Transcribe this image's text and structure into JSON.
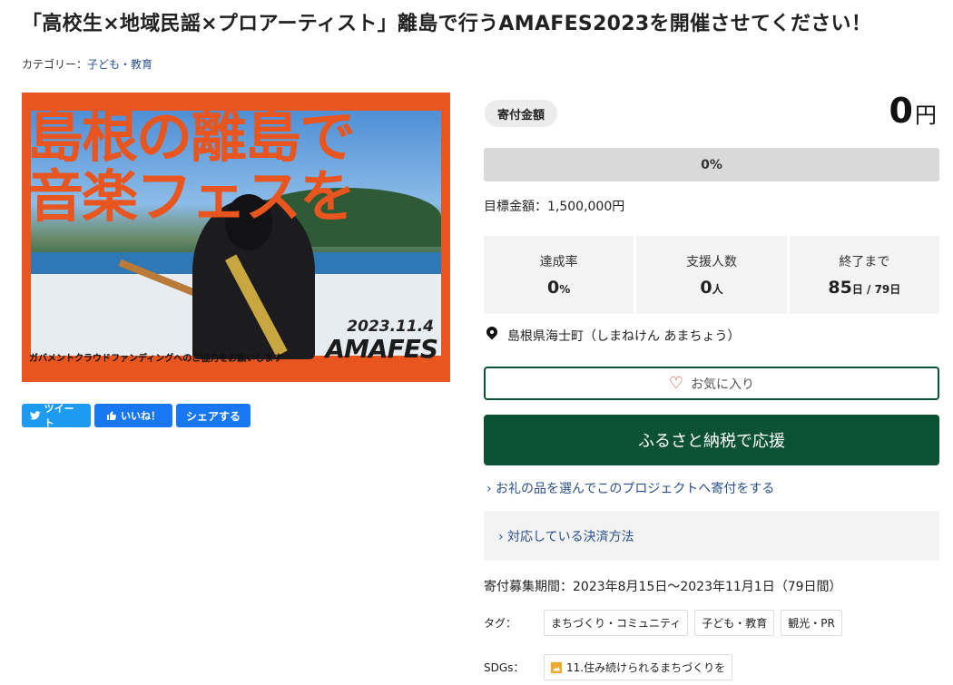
{
  "page": {
    "title": "「高校生×地域民謡×プロアーティスト」離島で行うAMAFES2023を開催させてください！",
    "category_label": "カテゴリー：",
    "category_value": "子ども・教育"
  },
  "hero": {
    "headline_line1": "島根の離島で",
    "headline_line2": "音楽フェスを",
    "date": "2023.11.4",
    "logo_text": "AMAFES",
    "caption": "ガバメントクラウドファンディングへのご協力をお願いします"
  },
  "social": {
    "tweet": "ツイート",
    "like": "いいね！",
    "share": "シェアする"
  },
  "donation": {
    "label": "寄付金額",
    "amount": "0",
    "unit": "円",
    "progress_text": "0%",
    "progress_fraction": 0,
    "target_label": "目標金額：",
    "target_value": "1,500,000円"
  },
  "stats": [
    {
      "label": "達成率",
      "value": "0",
      "unit": "%"
    },
    {
      "label": "支援人数",
      "value": "0",
      "unit": "人"
    },
    {
      "label": "終了まで",
      "value": "85",
      "unit": "日",
      "sub": " / 79日"
    }
  ],
  "location": {
    "text": "島根県海士町（しまねけん あまちょう）"
  },
  "favorite": {
    "label": "お気に入り"
  },
  "furusato_button": "ふるさと納税で応援",
  "gift_link": "› お礼の品を選んでこのプロジェクトへ寄付をする",
  "payment_link": "› 対応している決済方法",
  "period": {
    "label": "寄付募集期間：",
    "value": "2023年8月15日～2023年11月1日（79日間）"
  },
  "tags": {
    "label": "タグ：",
    "items": [
      "まちづくり・コミュニティ",
      "子ども・教育",
      "観光・PR"
    ]
  },
  "sdgs": {
    "label": "SDGs：",
    "items": [
      "11.住み続けられるまちづくりを"
    ]
  },
  "colors": {
    "brand_green": "#0b5133",
    "hero_orange": "#e8551f",
    "twitter_blue": "#1d9bf0",
    "facebook_blue": "#1877f2"
  }
}
